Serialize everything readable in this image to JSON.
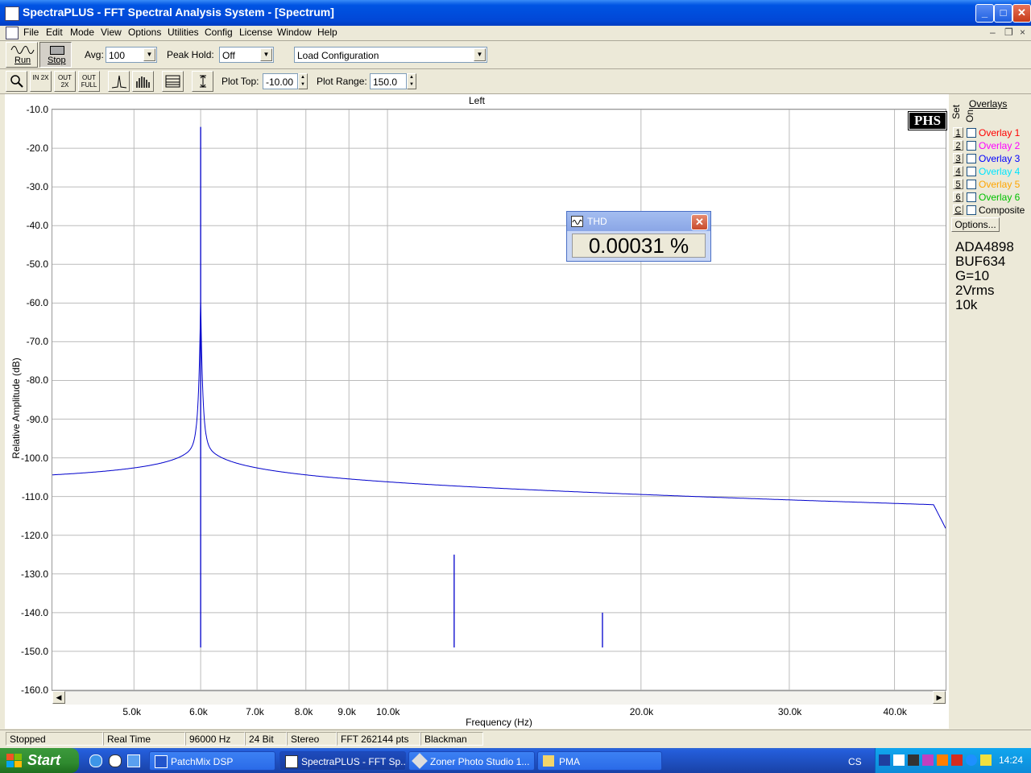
{
  "window": {
    "title": "SpectraPLUS - FFT Spectral Analysis System - [Spectrum]",
    "min_glyph": "_",
    "max_glyph": "□",
    "close_glyph": "✕"
  },
  "menu": [
    "File",
    "Edit",
    "Mode",
    "View",
    "Options",
    "Utilities",
    "Config",
    "License",
    "Window",
    "Help"
  ],
  "mdi_controls": [
    "–",
    "❐",
    "×"
  ],
  "toolbar1": {
    "run_label": "Run",
    "stop_label": "Stop",
    "avg_label": "Avg:",
    "avg_value": "100",
    "peakhold_label": "Peak Hold:",
    "peakhold_value": "Off",
    "config_value": "Load Configuration"
  },
  "toolbar2": {
    "zoom_in_label": "IN 2X",
    "zoom_out_label": "OUT 2X",
    "zoom_full_label": "OUT FULL",
    "plot_top_label": "Plot Top:",
    "plot_top_value": "-10.00",
    "plot_range_label": "Plot Range:",
    "plot_range_value": "150.0"
  },
  "plot": {
    "channel_title": "Left",
    "logo_text": "PHS"
  },
  "chart_data": {
    "type": "line",
    "title": "Left",
    "xlabel": "Frequency (Hz)",
    "ylabel": "Relative Amplitude (dB)",
    "x_scale": "log",
    "xlim": [
      4000,
      46000
    ],
    "ylim": [
      -160,
      -10
    ],
    "grid": true,
    "x_ticks": [
      {
        "value": 5000,
        "label": "5.0k"
      },
      {
        "value": 6000,
        "label": "6.0k"
      },
      {
        "value": 7000,
        "label": "7.0k"
      },
      {
        "value": 8000,
        "label": "8.0k"
      },
      {
        "value": 9000,
        "label": "9.0k"
      },
      {
        "value": 10000,
        "label": "10.0k"
      },
      {
        "value": 20000,
        "label": "20.0k"
      },
      {
        "value": 30000,
        "label": "30.0k"
      },
      {
        "value": 40000,
        "label": "40.0k"
      }
    ],
    "y_ticks": [
      -10,
      -20,
      -30,
      -40,
      -50,
      -60,
      -70,
      -80,
      -90,
      -100,
      -110,
      -120,
      -130,
      -140,
      -150,
      -160
    ],
    "y_tick_labels": [
      "-10.0",
      "-20.0",
      "-30.0",
      "-40.0",
      "-50.0",
      "-60.0",
      "-70.0",
      "-80.0",
      "-90.0",
      "-100.0",
      "-110.0",
      "-120.0",
      "-130.0",
      "-140.0",
      "-150.0",
      "-160.0"
    ],
    "series": [
      {
        "color": "#0000cc",
        "noise_floor_db": -150,
        "peaks": [
          {
            "freq": 6000,
            "db": -14.5
          },
          {
            "freq": 12000,
            "db": -125
          },
          {
            "freq": 18000,
            "db": -140
          }
        ]
      }
    ]
  },
  "overlays": {
    "header": "Overlays",
    "set_label": "Set",
    "on_label": "On",
    "items": [
      {
        "num": "1",
        "label": "Overlay 1",
        "color": "#ff0000"
      },
      {
        "num": "2",
        "label": "Overlay 2",
        "color": "#ff00ff"
      },
      {
        "num": "3",
        "label": "Overlay 3",
        "color": "#0000ff"
      },
      {
        "num": "4",
        "label": "Overlay 4",
        "color": "#00e5ff"
      },
      {
        "num": "5",
        "label": "Overlay 5",
        "color": "#ffa500"
      },
      {
        "num": "6",
        "label": "Overlay 6",
        "color": "#00c000"
      },
      {
        "num": "C",
        "label": "Composite",
        "color": "#000000"
      }
    ],
    "options_label": "Options..."
  },
  "notes": [
    "ADA4898",
    "BUF634",
    "G=10",
    "2Vrms",
    "10k"
  ],
  "thd": {
    "title": "THD",
    "value": "0.00031 %"
  },
  "status": [
    "Stopped",
    "Real Time",
    "96000 Hz",
    "24 Bit",
    "Stereo",
    "FFT 262144 pts",
    "Blackman"
  ],
  "taskbar": {
    "start_label": "Start",
    "tasks": [
      "PatchMix DSP",
      "SpectraPLUS - FFT Sp...",
      "Zoner Photo Studio 1...",
      "PMA"
    ],
    "lang": "CS",
    "clock": "14:24"
  }
}
